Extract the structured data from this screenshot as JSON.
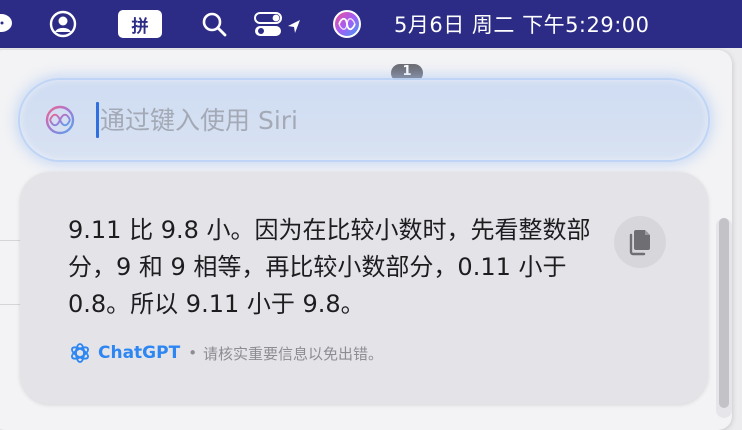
{
  "menubar": {
    "input_method_label": "拼",
    "clock": "5月6日 周二 下午5:29:00",
    "icons": [
      "chat-bubble-icon",
      "user-circle-icon",
      "search-icon",
      "control-center-icon",
      "location-arrow-icon",
      "siri-icon"
    ]
  },
  "background_window": {
    "badge_count": "1"
  },
  "siri": {
    "placeholder": "通过键入使用 Siri",
    "value": ""
  },
  "answer": {
    "text": "9.11 比 9.8 小。因为在比较小数时，先看整数部分，9 和 9 相等，再比较小数部分，0.11 小于 0.8。所以 9.11 小于 9.8。",
    "source_name": "ChatGPT",
    "separator": "•",
    "disclaimer": "请核实重要信息以免出错。"
  },
  "colors": {
    "menubar": "#2c2c86",
    "accent": "#2d86f2",
    "caret": "#2f6fe0"
  }
}
